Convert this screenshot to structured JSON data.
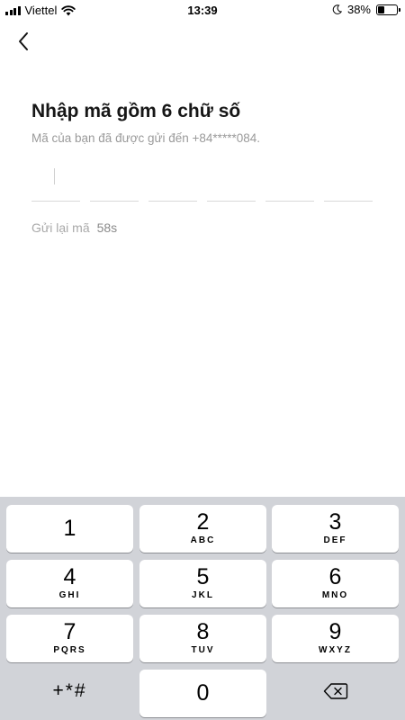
{
  "status_bar": {
    "carrier": "Viettel",
    "time": "13:39",
    "battery": "38%",
    "battery_level": 0.38
  },
  "verification": {
    "title": "Nhập mã gồm 6 chữ số",
    "subtitle": "Mã của bạn đã được gửi đến +84*****084.",
    "resend_label": "Gửi lại mã",
    "countdown": "58s",
    "code_slots": 6
  },
  "keypad": {
    "keys": [
      {
        "digit": "1",
        "letters": ""
      },
      {
        "digit": "2",
        "letters": "ABC"
      },
      {
        "digit": "3",
        "letters": "DEF"
      },
      {
        "digit": "4",
        "letters": "GHI"
      },
      {
        "digit": "5",
        "letters": "JKL"
      },
      {
        "digit": "6",
        "letters": "MNO"
      },
      {
        "digit": "7",
        "letters": "PQRS"
      },
      {
        "digit": "8",
        "letters": "TUV"
      },
      {
        "digit": "9",
        "letters": "WXYZ"
      },
      {
        "digit": "0",
        "letters": ""
      }
    ],
    "symbols_label": "+*#"
  },
  "icons": {
    "back": "chevron-left-icon",
    "delete": "backspace-icon",
    "signal": "cellular-signal-icon",
    "wifi": "wifi-icon",
    "moon": "do-not-disturb-moon-icon",
    "battery": "battery-icon"
  }
}
